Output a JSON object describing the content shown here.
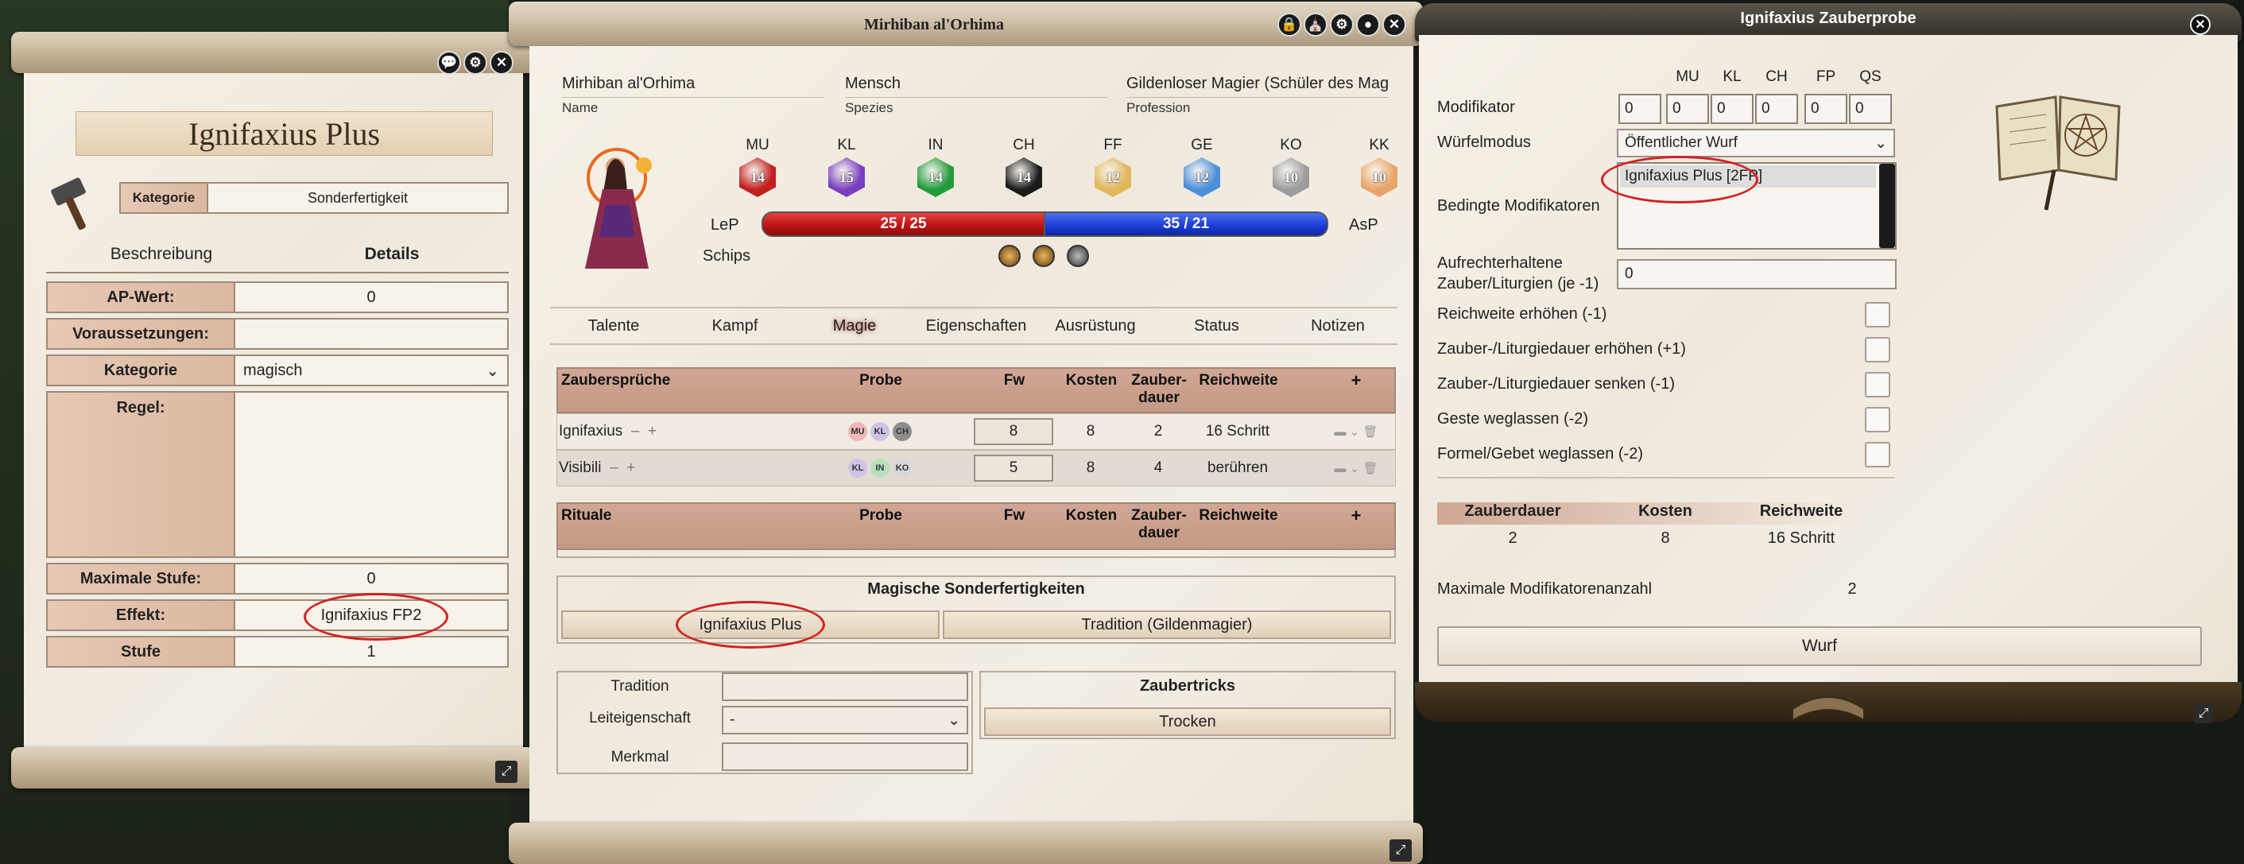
{
  "item_window": {
    "title": "Ignifaxius Plus",
    "category_label": "Kategorie",
    "category_value": "Sonderfertigkeit",
    "tabs": [
      "Beschreibung",
      "Details"
    ],
    "rows": [
      {
        "label": "AP-Wert:",
        "value": "0"
      },
      {
        "label": "Voraussetzungen:",
        "value": ""
      },
      {
        "label": "Kategorie",
        "value": "magisch"
      },
      {
        "label": "Regel:",
        "value": ""
      },
      {
        "label": "Maximale Stufe:",
        "value": "0"
      },
      {
        "label": "Effekt:",
        "value": "Ignifaxius FP2"
      },
      {
        "label": "Stufe",
        "value": "1"
      }
    ]
  },
  "character_sheet": {
    "title": "Mirhiban al'Orhima",
    "name_value": "Mirhiban al'Orhima",
    "name_label": "Name",
    "species_value": "Mensch",
    "species_label": "Spezies",
    "profession_value": "Gildenloser Magier (Schüler des Mag",
    "profession_label": "Profession",
    "attributes": [
      {
        "label": "MU",
        "value": "14",
        "color": "#c21f1f"
      },
      {
        "label": "KL",
        "value": "15",
        "color": "#7a3fc0"
      },
      {
        "label": "IN",
        "value": "14",
        "color": "#239b3b"
      },
      {
        "label": "CH",
        "value": "14",
        "color": "#1b1b1b"
      },
      {
        "label": "FF",
        "value": "12",
        "color": "#e2b65a"
      },
      {
        "label": "GE",
        "value": "12",
        "color": "#4b8fd8"
      },
      {
        "label": "KO",
        "value": "10",
        "color": "#9c9c9c"
      },
      {
        "label": "KK",
        "value": "10",
        "color": "#e9a46a"
      }
    ],
    "lep_label": "LeP",
    "lep_text": "25  /  25",
    "asp_label": "AsP",
    "asp_text": "35  /  21",
    "schips_label": "Schips",
    "tabs": [
      "Talente",
      "Kampf",
      "Magie",
      "Eigenschaften",
      "Ausrüstung",
      "Status",
      "Notizen"
    ],
    "active_tab": "Magie",
    "spells_header": {
      "name": "Zaubersprüche",
      "probe": "Probe",
      "fw": "Fw",
      "kosten": "Kosten",
      "dauer": "Zauber-\ndauer",
      "reichweite": "Reichweite",
      "add": "+"
    },
    "spells": [
      {
        "name": "Ignifaxius",
        "probe": [
          "MU",
          "KL",
          "CH"
        ],
        "fw": "8",
        "kosten": "8",
        "dauer": "2",
        "reichweite": "16 Schritt"
      },
      {
        "name": "Visibili",
        "probe": [
          "KL",
          "IN",
          "KO"
        ],
        "fw": "5",
        "kosten": "8",
        "dauer": "4",
        "reichweite": "berühren"
      }
    ],
    "rituals_header": {
      "name": "Rituale",
      "probe": "Probe",
      "fw": "Fw",
      "kosten": "Kosten",
      "dauer": "Zauber-\ndauer",
      "reichweite": "Reichweite",
      "add": "+"
    },
    "magic_sf_title": "Magische Sonderfertigkeiten",
    "magic_sf": [
      "Ignifaxius Plus",
      "Tradition (Gildenmagier)"
    ],
    "tradition_label": "Tradition",
    "leiteigenschaft_label": "Leiteigenschaft",
    "leiteigenschaft_value": "-",
    "merkmal_label": "Merkmal",
    "zaubertricks_title": "Zaubertricks",
    "zaubertricks": [
      "Trocken"
    ]
  },
  "spell_dialog": {
    "title": "Ignifaxius Zauberprobe",
    "columns": [
      "MU",
      "KL",
      "CH",
      "FP",
      "QS"
    ],
    "modifikator_label": "Modifikator",
    "modifikator_values": [
      "0",
      "0",
      "0",
      "0",
      "0",
      "0"
    ],
    "wuerfelmodus_label": "Würfelmodus",
    "wuerfelmodus_value": "Öffentlicher Wurf",
    "bedingte_label": "Bedingte Modifikatoren",
    "bedingte_option": "Ignifaxius Plus [2FP]",
    "aufrecht_label_1": "Aufrechterhaltene",
    "aufrecht_label_2": "Zauber/Liturgien (je -1)",
    "aufrecht_value": "0",
    "options": [
      "Reichweite erhöhen (-1)",
      "Zauber-/Liturgiedauer erhöhen (+1)",
      "Zauber-/Liturgiedauer senken (-1)",
      "Geste weglassen (-2)",
      "Formel/Gebet weglassen (-2)"
    ],
    "summary_headers": [
      "Zauberdauer",
      "Kosten",
      "Reichweite"
    ],
    "summary_values": [
      "2",
      "8",
      "16 Schritt"
    ],
    "max_mod_label": "Maximale Modifikatorenanzahl",
    "max_mod_value": "2",
    "roll_label": "Wurf"
  }
}
